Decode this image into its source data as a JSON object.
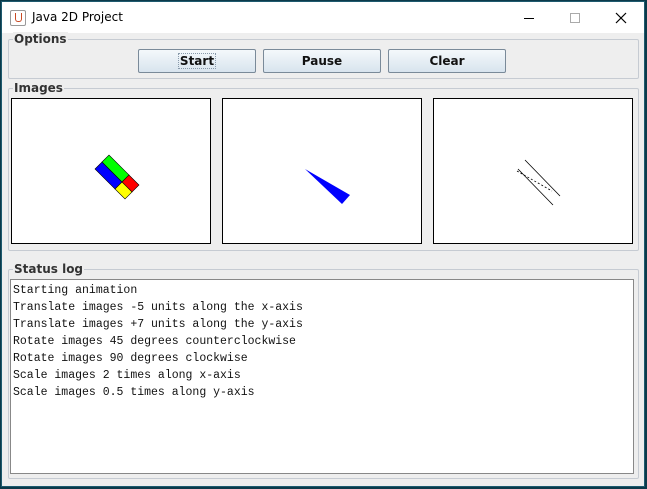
{
  "window": {
    "title": "Java 2D Project"
  },
  "options": {
    "legend": "Options",
    "start_label": "Start",
    "pause_label": "Pause",
    "clear_label": "Clear"
  },
  "images": {
    "legend": "Images"
  },
  "status": {
    "legend": "Status log",
    "lines": [
      "Starting animation",
      "Translate images -5 units along the x-axis",
      "Translate images +7 units along the y-axis",
      "Rotate images 45 degrees counterclockwise",
      "Rotate images 90 degrees clockwise",
      "Scale images 2 times along x-axis",
      "Scale images 0.5 times along y-axis"
    ]
  },
  "colors": {
    "shape_blue": "#0000ff",
    "shape_green": "#00ff00",
    "shape_red": "#ff0000",
    "shape_yellow": "#ffff00"
  },
  "icons": [
    "java-app-icon",
    "minimize-icon",
    "maximize-icon",
    "close-icon"
  ]
}
